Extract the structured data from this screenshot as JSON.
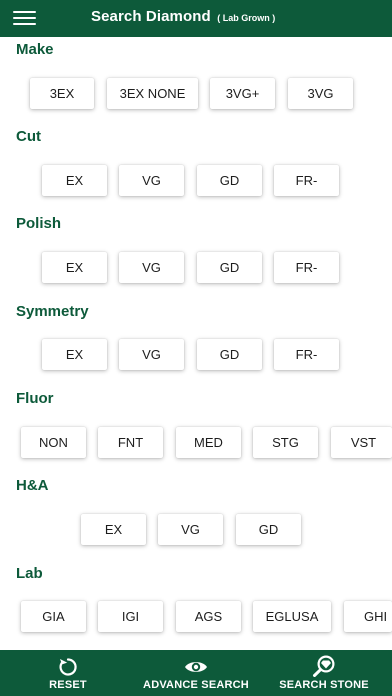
{
  "header": {
    "title": "Search Diamond",
    "subtitle": "( Lab Grown )"
  },
  "sections": {
    "make": {
      "label": "Make",
      "options": [
        "3EX",
        "3EX NONE",
        "3VG+",
        "3VG"
      ]
    },
    "cut": {
      "label": "Cut",
      "options": [
        "EX",
        "VG",
        "GD",
        "FR-"
      ]
    },
    "polish": {
      "label": "Polish",
      "options": [
        "EX",
        "VG",
        "GD",
        "FR-"
      ]
    },
    "symmetry": {
      "label": "Symmetry",
      "options": [
        "EX",
        "VG",
        "GD",
        "FR-"
      ]
    },
    "fluor": {
      "label": "Fluor",
      "options": [
        "NON",
        "FNT",
        "MED",
        "STG",
        "VST"
      ]
    },
    "ha": {
      "label": "H&A",
      "options": [
        "EX",
        "VG",
        "GD"
      ]
    },
    "lab": {
      "label": "Lab",
      "options": [
        "GIA",
        "IGI",
        "AGS",
        "EGLUSA",
        "GHI"
      ]
    }
  },
  "footer": {
    "reset_label": "RESET",
    "advance_label": "ADVANCE SEARCH",
    "stone_label": "SEARCH STONE",
    "reset_icon": "refresh-icon",
    "advance_icon": "eye-icon",
    "stone_icon": "search-diamond-icon"
  },
  "colors": {
    "brand_green": "#0d5a3a",
    "chip_background": "#ffffff",
    "chip_text": "#1d1d1d"
  }
}
